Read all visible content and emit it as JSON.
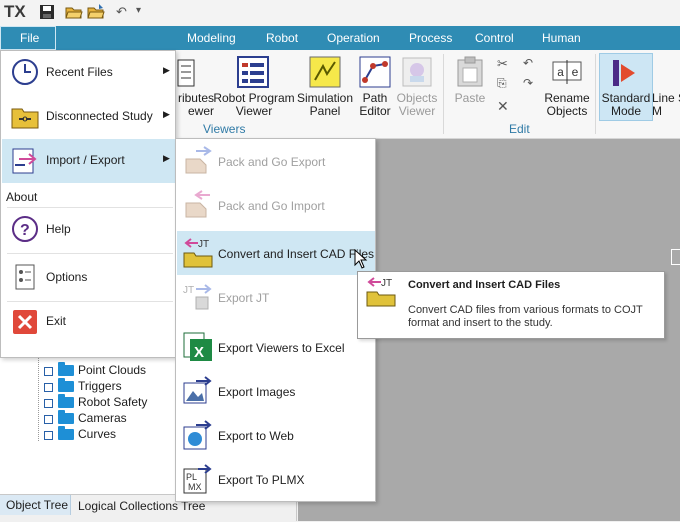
{
  "app": {
    "logo": "TX"
  },
  "quick_access": {
    "undo_label": "↶",
    "more_label": "▾"
  },
  "ribbon": {
    "tabs": [
      "Modeling",
      "Robot",
      "Operation",
      "Process",
      "Control",
      "Human"
    ],
    "buttons": {
      "attributes_viewer": "ributes\newer",
      "robot_program_viewer": "Robot Program\nViewer",
      "simulation_panel": "Simulation\nPanel",
      "path_editor": "Path\nEditor",
      "objects_viewer": "Objects\nViewer",
      "paste": "Paste",
      "rename_objects": "Rename\nObjects",
      "standard_mode": "Standard\nMode",
      "line_simulation": "Line S\nM"
    },
    "groups": {
      "viewers": "Viewers",
      "edit": "Edit"
    }
  },
  "file_menu": {
    "button_label": "File",
    "items": [
      {
        "label": "Recent Files",
        "has_submenu": true
      },
      {
        "label": "Disconnected Study",
        "has_submenu": true
      },
      {
        "label": "Import / Export",
        "has_submenu": true
      },
      {
        "label": "About",
        "is_heading": true
      },
      {
        "label": "Help"
      },
      {
        "label": "Options"
      },
      {
        "label": "Exit"
      }
    ]
  },
  "submenu": {
    "items": [
      {
        "label": "Pack and Go Export",
        "enabled": false
      },
      {
        "label": "Pack and Go Import",
        "enabled": false
      },
      {
        "label": "Convert and Insert CAD Files",
        "enabled": true,
        "hovered": true
      },
      {
        "label": "Export JT",
        "enabled": false
      },
      {
        "label": "Export Viewers to Excel",
        "enabled": true
      },
      {
        "label": "Export Images",
        "enabled": true
      },
      {
        "label": "Export to Web",
        "enabled": true
      },
      {
        "label": "Export To PLMX",
        "enabled": true
      }
    ]
  },
  "tooltip": {
    "title": "Convert and Insert CAD Files",
    "description": "Convert CAD files from various formats to COJT format and insert to the study."
  },
  "object_tree": {
    "items": [
      "Point Clouds",
      "Triggers",
      "Robot Safety",
      "Cameras",
      "Curves"
    ]
  },
  "bottom_tabs": [
    "Object Tree",
    "Logical Collections Tree"
  ],
  "icons": {
    "jt_label": "JT",
    "plmx_label": "PL MX"
  },
  "colors": {
    "accent": "#2f8cb4",
    "hover": "#cfe7f3",
    "tree_folder": "#1e8fd6"
  }
}
